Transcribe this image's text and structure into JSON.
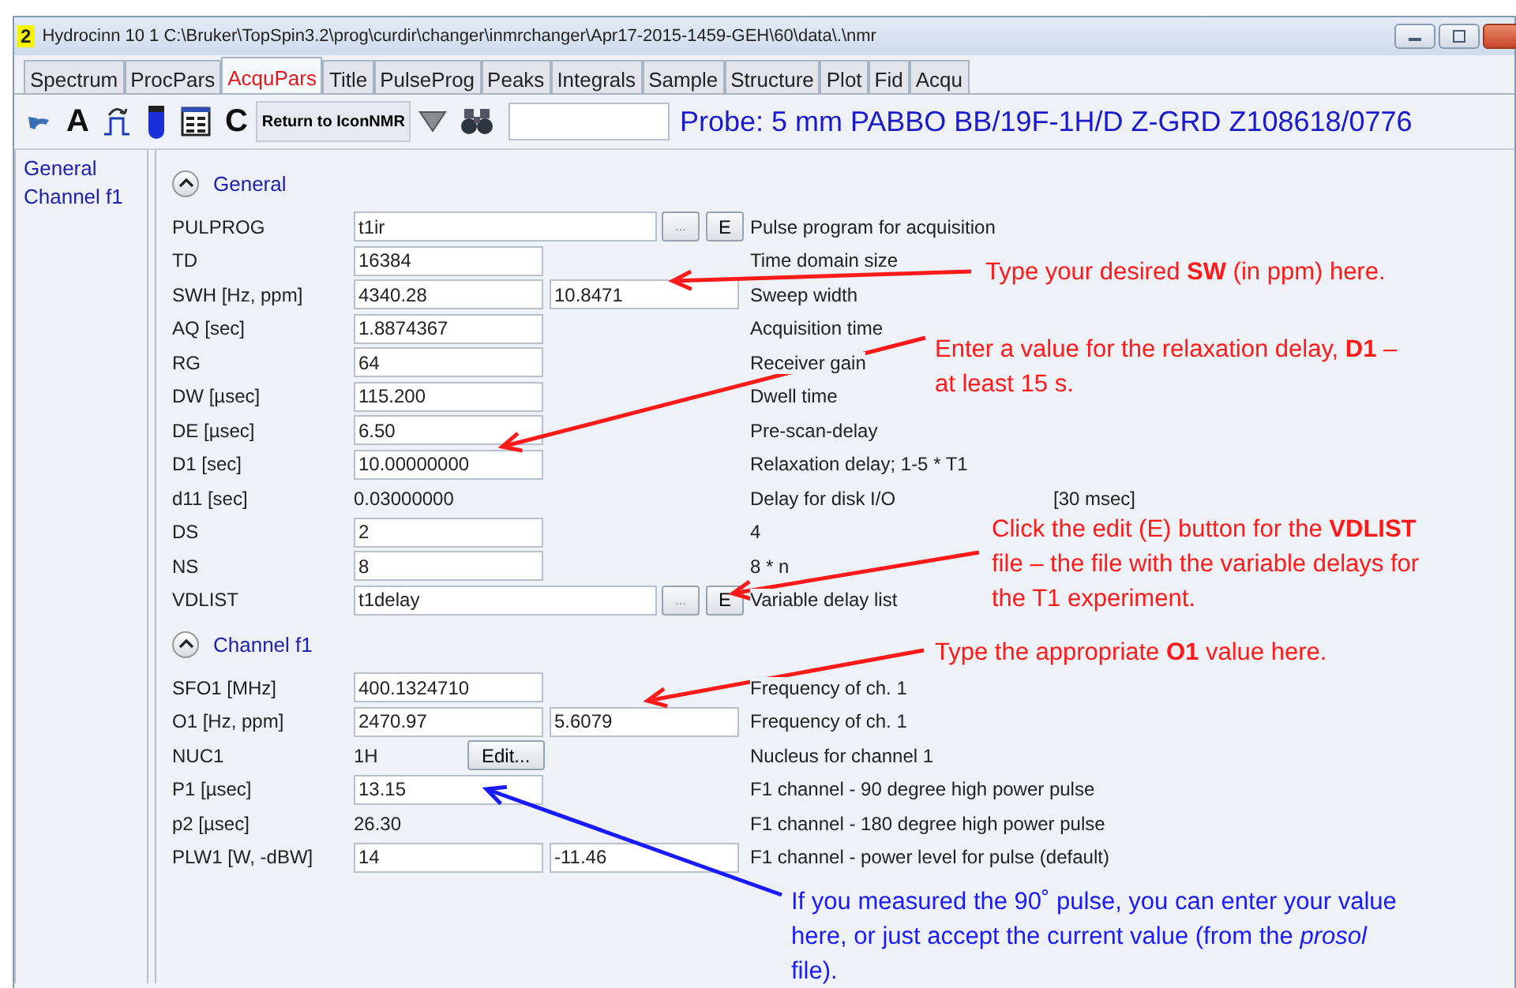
{
  "window": {
    "badge": "2",
    "title": "Hydrocinn  10  1  C:\\Bruker\\TopSpin3.2\\prog\\curdir\\changer\\inmrchanger\\Apr17-2015-1459-GEH\\60\\data\\.\\nmr"
  },
  "tabs": [
    {
      "label": "Spectrum",
      "selected": false
    },
    {
      "label": "ProcPars",
      "selected": false
    },
    {
      "label": "AcquPars",
      "selected": true
    },
    {
      "label": "Title",
      "selected": false
    },
    {
      "label": "PulseProg",
      "selected": false
    },
    {
      "label": "Peaks",
      "selected": false
    },
    {
      "label": "Integrals",
      "selected": false
    },
    {
      "label": "Sample",
      "selected": false
    },
    {
      "label": "Structure",
      "selected": false
    },
    {
      "label": "Plot",
      "selected": false
    },
    {
      "label": "Fid",
      "selected": false
    },
    {
      "label": "Acqu",
      "selected": false
    }
  ],
  "toolbar": {
    "letter_a": "A",
    "letter_c": "C",
    "return_button": "Return to IconNMR",
    "probe": "Probe: 5 mm PABBO BB/19F-1H/D Z-GRD Z108618/0776"
  },
  "sidebar": {
    "items": [
      {
        "label": "General",
        "selected": false
      },
      {
        "label": "Channel f1",
        "selected": false
      }
    ]
  },
  "sections": [
    {
      "title": "General",
      "expanded": true,
      "rows": [
        {
          "label": "PULPROG",
          "kind": "field_buttons",
          "value": "t1ir",
          "button_1": "...",
          "button_2": "E",
          "description": "Pulse program for acquisition"
        },
        {
          "label": "TD",
          "kind": "field",
          "value": "16384",
          "description": "Time domain size"
        },
        {
          "label": "SWH [Hz, ppm]",
          "kind": "field_pair",
          "value": "4340.28",
          "value_2": "10.8471",
          "description": "Sweep width"
        },
        {
          "label": "AQ [sec]",
          "kind": "field",
          "value": "1.8874367",
          "description": "Acquisition time"
        },
        {
          "label": "RG",
          "kind": "field",
          "value": "64",
          "description": "Receiver gain"
        },
        {
          "label": "DW [µsec]",
          "kind": "field",
          "value": "115.200",
          "description": "Dwell time"
        },
        {
          "label": "DE [µsec]",
          "kind": "field",
          "value": "6.50",
          "description": "Pre-scan-delay"
        },
        {
          "label": "D1 [sec]",
          "kind": "field",
          "value": "10.00000000",
          "description": "Relaxation delay; 1-5 * T1"
        },
        {
          "label": "d11 [sec]",
          "kind": "text",
          "value": "0.03000000",
          "description": "Delay for disk I/O",
          "note": "[30 msec]"
        },
        {
          "label": "DS",
          "kind": "field",
          "value": "2",
          "description": "4"
        },
        {
          "label": "NS",
          "kind": "field",
          "value": "8",
          "description": "8 * n"
        },
        {
          "label": "VDLIST",
          "kind": "field_buttons",
          "value": "t1delay",
          "button_1": "...",
          "button_2": "E",
          "description": "Variable delay list"
        }
      ]
    },
    {
      "title": "Channel f1",
      "expanded": true,
      "rows": [
        {
          "label": "SFO1 [MHz]",
          "kind": "field",
          "value": "400.1324710",
          "description": "Frequency of ch. 1"
        },
        {
          "label": "O1 [Hz, ppm]",
          "kind": "field_pair",
          "value": "2470.97",
          "value_2": "5.6079",
          "description": "Frequency of ch. 1"
        },
        {
          "label": "NUC1",
          "kind": "text_edit",
          "value": "1H",
          "button_1": "Edit...",
          "description": "Nucleus for channel 1"
        },
        {
          "label": "P1 [µsec]",
          "kind": "field",
          "value": "13.15",
          "description": "F1 channel -  90 degree high power pulse"
        },
        {
          "label": "p2 [µsec]",
          "kind": "text",
          "value": "26.30",
          "description": "F1 channel - 180 degree high power pulse"
        },
        {
          "label": "PLW1 [W, -dBW]",
          "kind": "field_pair",
          "value": "14",
          "value_2": "-11.46",
          "description": "F1 channel - power level for pulse (default)"
        }
      ]
    }
  ],
  "annotations": [
    {
      "color": "#ff1a1a",
      "lines": [
        "Type your desired **SW** (in ppm) here."
      ]
    },
    {
      "color": "#ff1a1a",
      "lines": [
        "Enter a value for the relaxation delay, **D1** –",
        "at least 15 s."
      ]
    },
    {
      "color": "#ff1a1a",
      "lines": [
        "Click the edit (E) button for the **VDLIST**",
        "file – the file with the variable delays for",
        "the T1 experiment."
      ]
    },
    {
      "color": "#ff1a1a",
      "lines": [
        "Type the appropriate **O1** value here."
      ]
    },
    {
      "color": "#1a1aff",
      "lines": [
        "If you measured the 90˚ pulse, you can enter your value",
        "here, or just accept the current value (from the *prosol*",
        "file)."
      ]
    }
  ]
}
